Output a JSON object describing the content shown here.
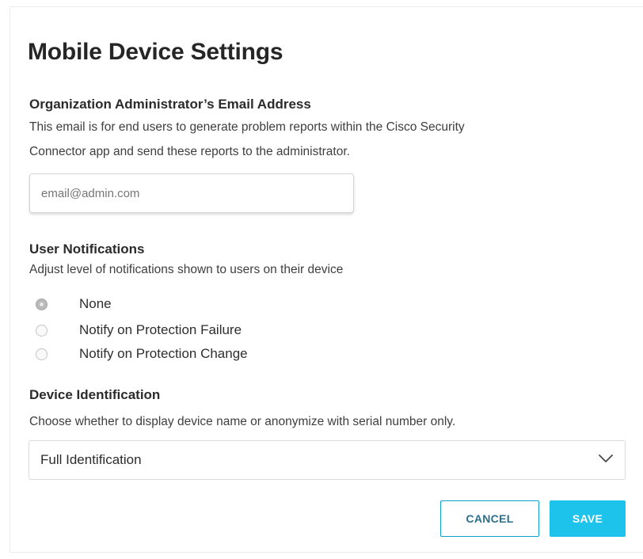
{
  "title": "Mobile Device Settings",
  "admin_email": {
    "heading": "Organization Administrator’s Email Address",
    "description_line1": "This email is for end users to generate problem reports within the Cisco Security",
    "description_line2": "Connector app and send these reports to the administrator.",
    "placeholder": "email@admin.com",
    "value": ""
  },
  "notifications": {
    "heading": "User Notifications",
    "description": "Adjust level of notifications shown to users on their device",
    "options": [
      {
        "label": "None",
        "selected": true
      },
      {
        "label": "Notify on Protection Failure",
        "selected": false
      },
      {
        "label": "Notify on Protection Change",
        "selected": false
      }
    ]
  },
  "device_identification": {
    "heading": "Device Identification",
    "description": "Choose whether to display device name or anonymize with serial number only.",
    "selected": "Full Identification",
    "dropdown_icon": "chevron-down-icon"
  },
  "actions": {
    "cancel_label": "CANCEL",
    "save_label": "SAVE"
  },
  "colors": {
    "accent": "#1ec3ec",
    "cancel_border": "#0fa0c9",
    "text": "#2a2a2a"
  }
}
